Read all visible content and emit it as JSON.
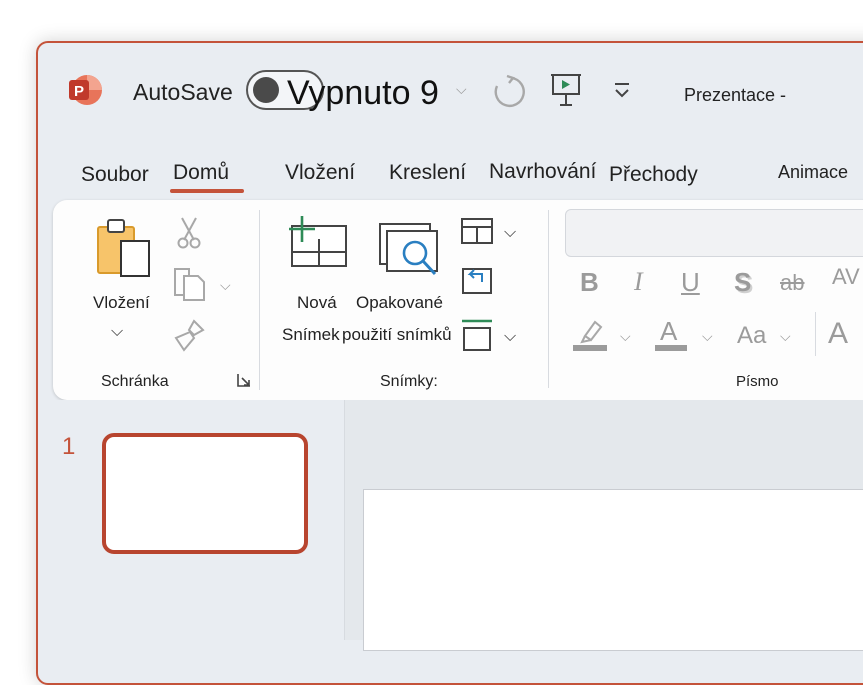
{
  "titlebar": {
    "autosave_label": "AutoSave",
    "autosave_state": "Vypnuto 9",
    "document_title": "Prezentace -"
  },
  "tabs": [
    {
      "label": "Soubor"
    },
    {
      "label": "Domů",
      "active": true
    },
    {
      "label": "Vložení"
    },
    {
      "label": "Kreslení"
    },
    {
      "label": "Navrhování"
    },
    {
      "label": "Přechody"
    },
    {
      "label": "Animace"
    }
  ],
  "ribbon": {
    "clipboard": {
      "paste_label": "Vložení",
      "group_label": "Schránka"
    },
    "slides": {
      "new_slide_line1": "Nová",
      "new_slide_line2": "Snímek",
      "reuse_line1": "Opakované",
      "reuse_line2": "použití snímků",
      "group_label": "Snímky:"
    },
    "font": {
      "bold": "B",
      "italic": "I",
      "underline": "U",
      "shadow": "S",
      "strikethrough": "ab",
      "spacing": "AV",
      "font_color": "A",
      "change_case": "Aa",
      "grow_font": "A",
      "group_label": "Písmo"
    }
  },
  "slides_pane": {
    "slide_number": "1"
  },
  "colors": {
    "accent": "#c4533a",
    "window_bg": "#e9edf2",
    "ribbon_bg": "#fdfdfd"
  },
  "icons": [
    "powerpoint-logo-icon",
    "redo-icon",
    "present-from-start-icon",
    "chevron-down-icon",
    "paste-icon",
    "cut-icon",
    "copy-icon",
    "format-painter-icon",
    "new-slide-icon",
    "reuse-slides-icon",
    "layout-icon",
    "reset-icon",
    "section-icon",
    "highlight-icon"
  ]
}
